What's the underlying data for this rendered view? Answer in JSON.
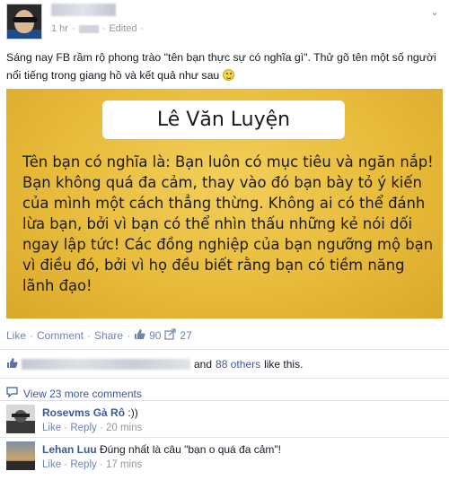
{
  "post": {
    "meta_time": "1 hr",
    "meta_edited": "Edited",
    "text": "Sáng nay FB rầm rộ phong trào \"tên bạn thực sự có nghĩa gì\". Thử gõ tên một số người nổi tiếng trong giang hồ và kết quả như sau",
    "image": {
      "name": "Lê Văn Luyện",
      "result": "Tên bạn có nghĩa là: Bạn luôn có mục tiêu và ngăn nắp! Bạn không quá đa cảm, thay vào đó bạn bày tỏ ý kiến của mình một cách thẳng thừng. Không ai có thể đánh lừa bạn, bởi vì bạn có thể nhìn thấu những kẻ nói dối ngay lập tức! Các đồng nghiệp của bạn ngưỡng mộ bạn vì điều đó, bởi vì họ đều biết rằng bạn có tiềm năng lãnh đạo!"
    }
  },
  "actions": {
    "like": "Like",
    "comment": "Comment",
    "share": "Share",
    "like_count": "90",
    "share_count": "27"
  },
  "likes": {
    "and": "and",
    "others": "88 others",
    "suffix": "like this."
  },
  "view_more": "View 23 more comments",
  "comments": [
    {
      "author": "Rosevms Gà Rô",
      "text": ":))",
      "like": "Like",
      "reply": "Reply",
      "time": "20 mins"
    },
    {
      "author": "Lehan Luu",
      "text": "Đúng nhất là câu \"bạn o quá đa cảm\"!",
      "like": "Like",
      "reply": "Reply",
      "time": "17 mins"
    }
  ],
  "colors": {
    "link": "#3b5998",
    "card": "#e8bb3a",
    "muted": "#9197a3"
  }
}
